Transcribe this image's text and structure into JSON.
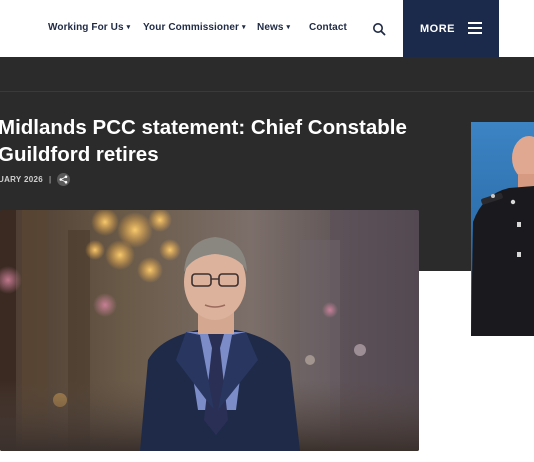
{
  "nav": {
    "items": [
      {
        "label": "Working For Us",
        "has_dropdown": true
      },
      {
        "label": "Your Commissioner",
        "has_dropdown": true
      },
      {
        "label": "News",
        "has_dropdown": true
      },
      {
        "label": "Contact",
        "has_dropdown": false
      }
    ],
    "caret": "▾",
    "search_icon": "search-icon",
    "more_label": "MORE",
    "menu_icon": "hamburger-icon"
  },
  "article": {
    "headline_line1": "Midlands PCC statement: Chief Constable",
    "headline_line2": "Guildford retires",
    "date": "UARY 2026",
    "separator": "|",
    "share_icon": "share-icon"
  },
  "colors": {
    "nav_text": "#1f2a44",
    "more_bg": "#1b2a4a",
    "hero_bg": "#2b2b2b",
    "headline": "#ffffff"
  }
}
